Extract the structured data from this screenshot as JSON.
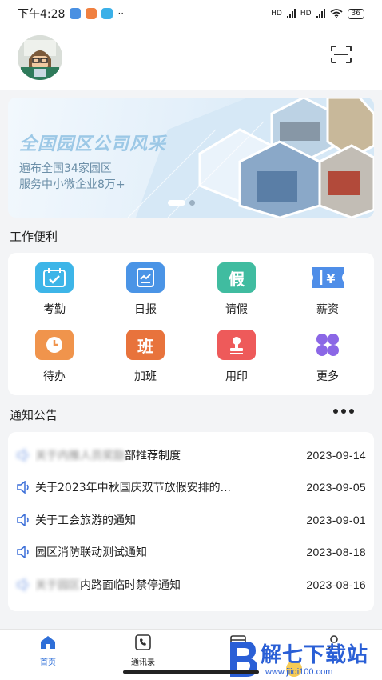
{
  "status_bar": {
    "time": "下午4:28",
    "network_1": "HD",
    "network_2": "HD",
    "battery": "36"
  },
  "header": {
    "avatar_icon": "user-avatar",
    "scan_icon": "scan-icon"
  },
  "banner": {
    "title": "全国园区公司风采",
    "line1": "遍布全国34家园区",
    "line2": "服务中小微企业8万+"
  },
  "work": {
    "title": "工作便利",
    "items": [
      {
        "label": "考勤",
        "icon": "calendar-check-icon",
        "color": "#3db5e8",
        "glyph": "✓"
      },
      {
        "label": "日报",
        "icon": "report-icon",
        "color": "#4a94e6",
        "glyph": "▤"
      },
      {
        "label": "请假",
        "icon": "leave-icon",
        "color": "#40bca0",
        "glyph": "假"
      },
      {
        "label": "薪资",
        "icon": "salary-ticket-icon",
        "color": "#4f8ee8",
        "glyph": "¥"
      },
      {
        "label": "待办",
        "icon": "clock-icon",
        "color": "#f0944c",
        "glyph": "◷"
      },
      {
        "label": "加班",
        "icon": "overtime-icon",
        "color": "#e8733c",
        "glyph": "班"
      },
      {
        "label": "用印",
        "icon": "stamp-icon",
        "color": "#ee5a5a",
        "glyph": "⊥"
      },
      {
        "label": "更多",
        "icon": "more-grid-icon",
        "color": "#8b67e6",
        "glyph": "✤"
      }
    ]
  },
  "notices": {
    "title": "通知公告",
    "items": [
      {
        "text": "部推荐制度",
        "date": "2023-09-14",
        "blur_prefix": "关于内推人员奖励"
      },
      {
        "text": "关于2023年中秋国庆双节放假安排的...",
        "date": "2023-09-05"
      },
      {
        "text": "关于工会旅游的通知",
        "date": "2023-09-01"
      },
      {
        "text": "园区消防联动测试通知",
        "date": "2023-08-18"
      },
      {
        "text": "内路面临时禁停通知",
        "date": "2023-08-16",
        "blur_prefix": "关于园区"
      }
    ]
  },
  "bottom_nav": {
    "home": "首页",
    "contacts": "通讯录"
  },
  "watermark": {
    "brand": "解七下载站",
    "url": "www.jiiqi100.com"
  }
}
